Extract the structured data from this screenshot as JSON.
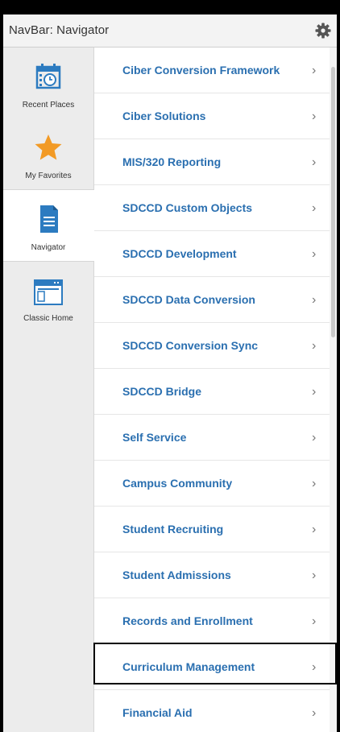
{
  "header": {
    "title": "NavBar: Navigator"
  },
  "sidebar": {
    "items": [
      {
        "label": "Recent Places",
        "icon": "calendar-clock-icon"
      },
      {
        "label": "My Favorites",
        "icon": "star-icon"
      },
      {
        "label": "Navigator",
        "icon": "document-icon",
        "active": true
      },
      {
        "label": "Classic Home",
        "icon": "window-icon"
      }
    ]
  },
  "navigator": {
    "items": [
      {
        "label": "Ciber Conversion Framework"
      },
      {
        "label": "Ciber Solutions"
      },
      {
        "label": "MIS/320 Reporting"
      },
      {
        "label": "SDCCD Custom Objects"
      },
      {
        "label": "SDCCD Development"
      },
      {
        "label": "SDCCD Data Conversion"
      },
      {
        "label": "SDCCD Conversion Sync"
      },
      {
        "label": "SDCCD Bridge"
      },
      {
        "label": "Self Service"
      },
      {
        "label": "Campus Community"
      },
      {
        "label": "Student Recruiting"
      },
      {
        "label": "Student Admissions"
      },
      {
        "label": "Records and Enrollment"
      },
      {
        "label": "Curriculum Management",
        "highlighted": true
      },
      {
        "label": "Financial Aid"
      }
    ],
    "chevron": "›"
  },
  "colors": {
    "link": "#2a6fb0",
    "icon_blue": "#2c7bc0",
    "star": "#f29a25",
    "highlight_border": "#000000"
  }
}
